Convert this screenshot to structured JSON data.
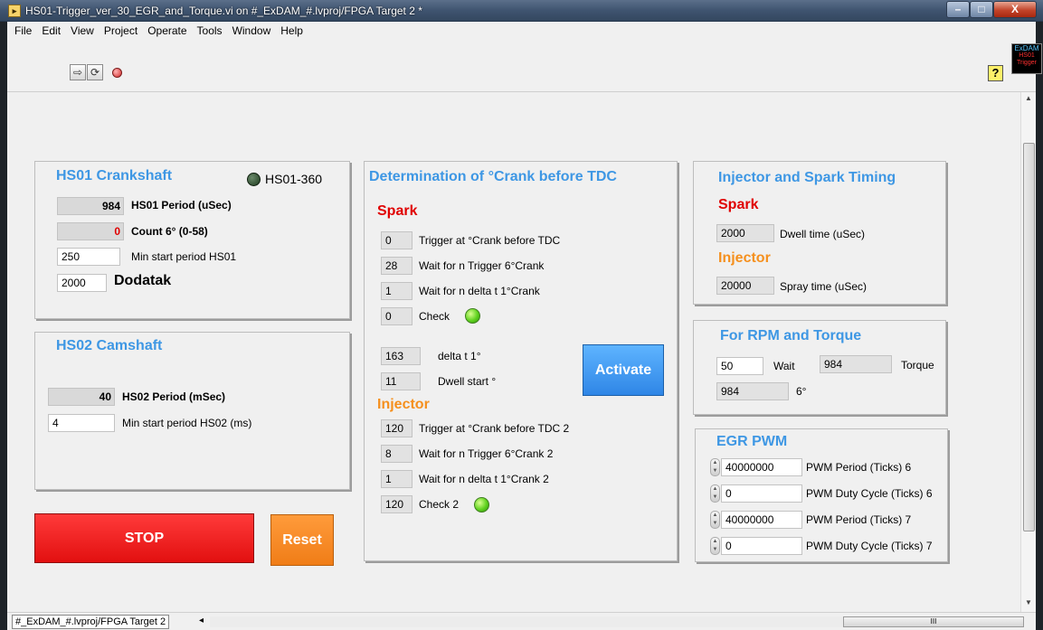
{
  "window": {
    "title": "HS01-Trigger_ver_30_EGR_and_Torque.vi on #_ExDAM_#.lvproj/FPGA Target 2 *",
    "minimize": "–",
    "maximize": "□",
    "close": "X"
  },
  "menu": [
    "File",
    "Edit",
    "View",
    "Project",
    "Operate",
    "Tools",
    "Window",
    "Help"
  ],
  "toolbar": {
    "run_icon": "⇨",
    "run_continuous_icon": "⟳",
    "help_glyph": "?",
    "vi_icon_line1": "ExDAM",
    "vi_icon_line2": "HS01",
    "vi_icon_line3": "Trigger"
  },
  "hs01": {
    "title": "HS01 Crankshaft",
    "led_label": "HS01-360",
    "period_value": "984",
    "period_label": "HS01 Period (uSec)",
    "count_value": "0",
    "count_label": "Count 6° (0-58)",
    "min_start_value": "250",
    "min_start_label": "Min start period HS01",
    "dodatak_value": "2000",
    "dodatak_label": "Dodatak"
  },
  "hs02": {
    "title": "HS02 Camshaft",
    "period_value": "40",
    "period_label": "HS02 Period (mSec)",
    "min_start_value": "4",
    "min_start_label": "Min start period HS02 (ms)"
  },
  "determination": {
    "title": "Determination of °Crank before TDC",
    "spark_heading": "Spark",
    "spark_rows": [
      {
        "value": "0",
        "label": "Trigger at °Crank before TDC"
      },
      {
        "value": "28",
        "label": "Wait for n Trigger 6°Crank"
      },
      {
        "value": "1",
        "label": "Wait for n delta t 1°Crank"
      },
      {
        "value": "0",
        "label": "Check"
      }
    ],
    "delta_value": "163",
    "delta_label": "delta t 1°",
    "dwell_value": "11",
    "dwell_label": "Dwell start °",
    "activate_label": "Activate",
    "injector_heading": "Injector",
    "injector_rows": [
      {
        "value": "120",
        "label": "Trigger at °Crank before TDC 2"
      },
      {
        "value": "8",
        "label": "Wait for n Trigger 6°Crank 2"
      },
      {
        "value": "1",
        "label": "Wait for n delta t 1°Crank 2"
      },
      {
        "value": "120",
        "label": "Check 2"
      }
    ]
  },
  "timing": {
    "title": "Injector and Spark Timing",
    "spark_heading": "Spark",
    "dwell_value": "2000",
    "dwell_label": "Dwell time (uSec)",
    "injector_heading": "Injector",
    "spray_value": "20000",
    "spray_label": "Spray time (uSec)"
  },
  "rpm": {
    "title": "For RPM and Torque",
    "wait_value": "50",
    "wait_label": "Wait",
    "torque_value": "984",
    "torque_label": "Torque",
    "six_value": "984",
    "six_label": "6°"
  },
  "egr": {
    "title": "EGR PWM",
    "rows": [
      {
        "value": "40000000",
        "label": "PWM Period (Ticks) 6"
      },
      {
        "value": "0",
        "label": "PWM Duty Cycle (Ticks) 6"
      },
      {
        "value": "40000000",
        "label": "PWM Period (Ticks) 7"
      },
      {
        "value": "0",
        "label": "PWM Duty Cycle (Ticks) 7"
      }
    ]
  },
  "buttons": {
    "stop": "STOP",
    "reset": "Reset"
  },
  "status": {
    "target": "#_ExDAM_#.lvproj/FPGA Target 2",
    "scroll_left": "◂",
    "hscroll_grip": "III"
  }
}
